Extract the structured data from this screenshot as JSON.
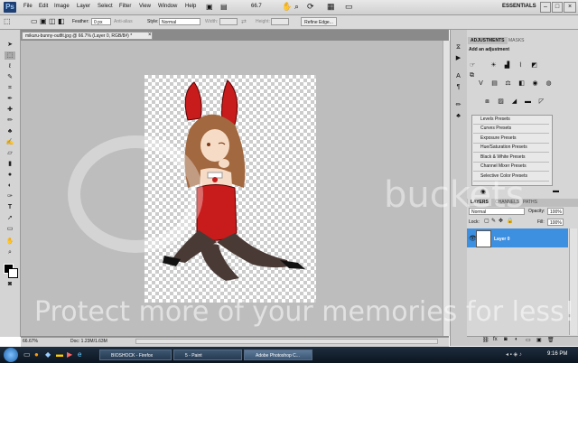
{
  "menubar": {
    "logo": "Ps",
    "items": [
      "File",
      "Edit",
      "Image",
      "Layer",
      "Select",
      "Filter",
      "View",
      "Window",
      "Help"
    ],
    "zoom": "66.7",
    "workspace": "ESSENTIALS"
  },
  "options": {
    "feather_label": "Feather:",
    "feather_value": "0 px",
    "antialias_label": "Anti-alias",
    "style_label": "Style:",
    "style_value": "Normal",
    "width_label": "Width:",
    "height_label": "Height:",
    "refine_label": "Refine Edge..."
  },
  "document": {
    "tab_title": "mikuru-bunny-outfit.jpg @ 66.7% (Layer 0, RGB/8#) *"
  },
  "status": {
    "zoom": "66.67%",
    "doc": "Doc: 1.23M/1.63M"
  },
  "adjustments": {
    "tab_active": "ADJUSTMENTS",
    "tab_other": "MASKS",
    "heading": "Add an adjustment",
    "presets": [
      "Levels Presets",
      "Curves Presets",
      "Exposure Presets",
      "Hue/Saturation Presets",
      "Black & White Presets",
      "Channel Mixer Presets",
      "Selective Color Presets"
    ]
  },
  "layers": {
    "tabs": [
      "LAYERS",
      "CHANNELS",
      "PATHS"
    ],
    "blend_mode": "Normal",
    "opacity_label": "Opacity:",
    "opacity_value": "100%",
    "lock_label": "Lock:",
    "fill_label": "Fill:",
    "fill_value": "100%",
    "layer_name": "Layer 0"
  },
  "taskbar": {
    "buttons": [
      "BIOSHOCK - Firefox",
      "5 - Paint",
      "Adobe Photoshop C..."
    ],
    "clock": "9:16 PM"
  },
  "watermark": {
    "line1": "buckets",
    "line2": "Protect more of your memories for less!"
  },
  "colors": {
    "layer_selected": "#3d8fe0",
    "taskbar": "#0c1520"
  }
}
